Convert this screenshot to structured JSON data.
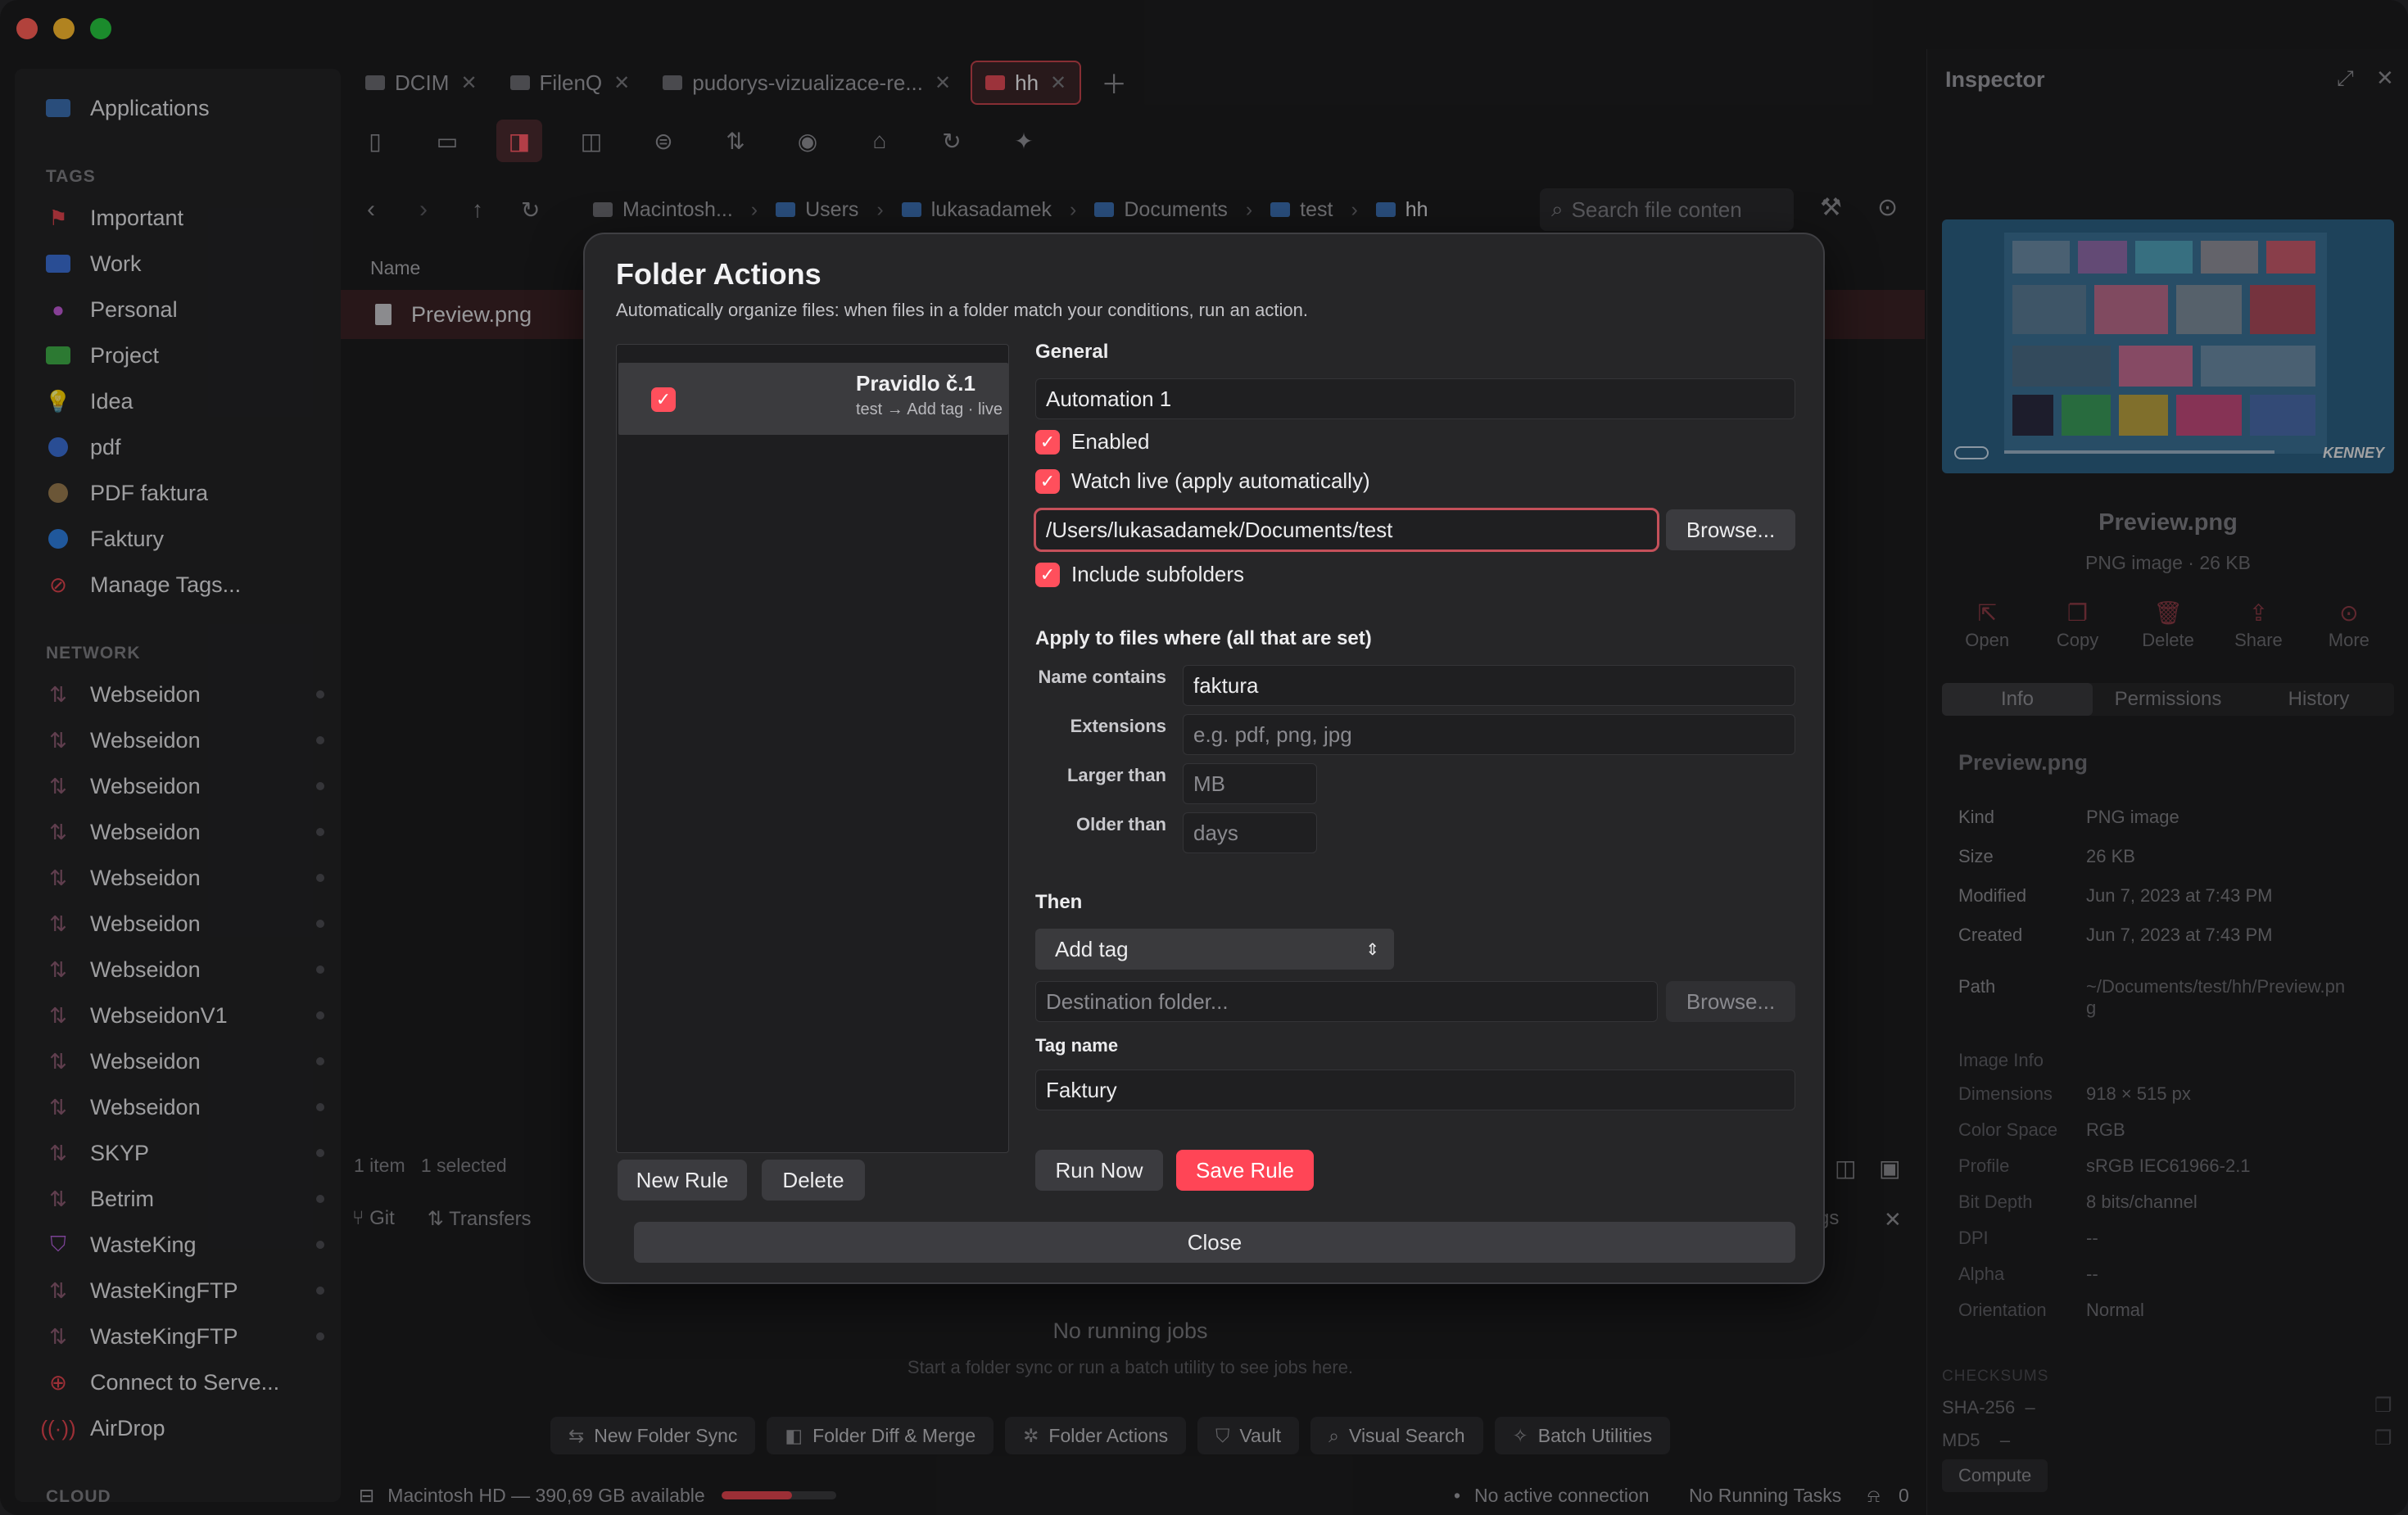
{
  "tabs": [
    {
      "label": "DCIM"
    },
    {
      "label": "FilenQ"
    },
    {
      "label": "pudorys-vizualizace-re..."
    },
    {
      "label": "hh"
    }
  ],
  "sidebar": {
    "top_item": "Applications",
    "tags_header": "TAGS",
    "tags": [
      {
        "label": "Important",
        "color": "#e0444e"
      },
      {
        "label": "Work",
        "color": "#3b6fd4"
      },
      {
        "label": "Personal",
        "color": "#c05bd6"
      },
      {
        "label": "Project",
        "color": "#3fae48"
      },
      {
        "label": "Idea",
        "color": "#f0c33c"
      },
      {
        "label": "pdf",
        "color": "#3b6fd4"
      },
      {
        "label": "PDF faktura",
        "color": "#9a7b4f"
      },
      {
        "label": "Faktury",
        "color": "#2f7fe0"
      }
    ],
    "manage_tags": "Manage Tags...",
    "network_header": "NETWORK",
    "network": [
      "Webseidon",
      "Webseidon",
      "Webseidon",
      "Webseidon",
      "Webseidon",
      "Webseidon",
      "Webseidon",
      "WebseidonV1",
      "Webseidon",
      "Webseidon",
      "SKYP",
      "Betrim",
      "WasteKing",
      "WasteKingFTP",
      "WasteKingFTP"
    ],
    "connect": "Connect to Serve...",
    "airdrop": "AirDrop",
    "cloud_header": "CLOUD"
  },
  "breadcrumbs": [
    "Macintosh...",
    "Users",
    "lukasadamek",
    "Documents",
    "test",
    "hh"
  ],
  "search_placeholder": "Search file conten",
  "list": {
    "name_header": "Name",
    "file": "Preview.png",
    "status_left": "1 item",
    "status_selected": "1 selected"
  },
  "bottom_tabs": {
    "git": "Git",
    "transfers": "Transfers",
    "tags_partial": "gs"
  },
  "jobs": {
    "title": "No running jobs",
    "subtitle": "Start a folder sync or run a batch utility to see jobs here."
  },
  "chips": [
    "New Folder Sync",
    "Folder Diff & Merge",
    "Folder Actions",
    "Vault",
    "Visual Search",
    "Batch Utilities"
  ],
  "statusbar": {
    "disk": "Macintosh HD — 390,69 GB available",
    "disk_used": 0.62,
    "connection": "No active connection",
    "tasks": "No Running Tasks",
    "bell_count": "0"
  },
  "inspector": {
    "title": "Inspector",
    "filename": "Preview.png",
    "subtitle": "PNG image · 26 KB",
    "actions": [
      "Open",
      "Copy",
      "Delete",
      "Share",
      "More"
    ],
    "tabs": [
      "Info",
      "Permissions",
      "History"
    ],
    "info_title": "Preview.png",
    "info": [
      {
        "k": "Kind",
        "v": "PNG image"
      },
      {
        "k": "Size",
        "v": "26 KB"
      },
      {
        "k": "Modified",
        "v": "Jun 7, 2023 at 7:43 PM"
      },
      {
        "k": "Created",
        "v": "Jun 7, 2023 at 7:43 PM"
      }
    ],
    "path_k": "Path",
    "path_v1": "~/Documents/test/hh/Preview.pn",
    "path_v2": "g",
    "image_info_title": "Image Info",
    "image_info": [
      {
        "k": "Dimensions",
        "v": "918 × 515 px"
      },
      {
        "k": "Color Space",
        "v": "RGB"
      },
      {
        "k": "Profile",
        "v": "sRGB IEC61966-2.1"
      },
      {
        "k": "Bit Depth",
        "v": "8 bits/channel"
      },
      {
        "k": "DPI",
        "v": "--"
      },
      {
        "k": "Alpha",
        "v": "--"
      },
      {
        "k": "Orientation",
        "v": "Normal"
      }
    ],
    "checksums_header": "CHECKSUMS",
    "sha": "SHA-256",
    "md5": "MD5",
    "dash": "–",
    "compute": "Compute",
    "thumb_badge": "KENNEY"
  },
  "modal": {
    "title": "Folder Actions",
    "subtitle": "Automatically organize files: when files in a folder match your conditions, run an action.",
    "rule_name": "Pravidlo č.1",
    "rule_desc": "test → Add tag · live",
    "general": "General",
    "name_value": "Automation 1",
    "enabled": "Enabled",
    "watch_live": "Watch live (apply automatically)",
    "path_value": "/Users/lukasadamek/Documents/test",
    "browse": "Browse...",
    "include_sub": "Include subfolders",
    "apply_header": "Apply to files where (all that are set)",
    "name_contains_label": "Name contains",
    "name_contains_value": "faktura",
    "extensions_label": "Extensions",
    "extensions_ph": "e.g. pdf, png, jpg",
    "larger_label": "Larger than",
    "larger_ph": "MB",
    "older_label": "Older than",
    "older_ph": "days",
    "then": "Then",
    "action": "Add tag",
    "dest_ph": "Destination folder...",
    "browse2": "Browse...",
    "tag_name_label": "Tag name",
    "tag_name_value": "Faktury",
    "new_rule": "New Rule",
    "delete": "Delete",
    "run_now": "Run Now",
    "save_rule": "Save Rule",
    "close": "Close"
  }
}
